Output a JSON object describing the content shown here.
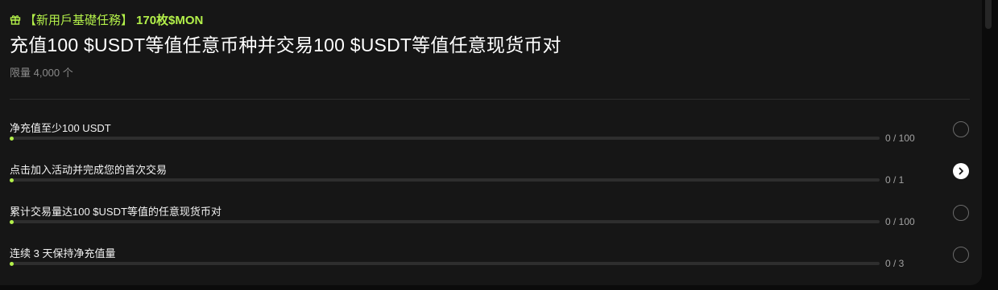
{
  "badge": {
    "icon": "gift-icon",
    "bracket_text": "【新用戶基礎任務】",
    "amount": "170枚$MON",
    "color": "#b3f04a"
  },
  "title": "充值100 $USDT等值任意币种并交易100 $USDT等值任意现货币对",
  "limit": "限量 4,000 个",
  "tasks": [
    {
      "label": "净充值至少100 USDT",
      "count": "0 / 100",
      "progress": 0,
      "status": "incomplete",
      "status_icon": "empty-circle-icon"
    },
    {
      "label": "点击加入活动并完成您的首次交易",
      "count": "0 / 1",
      "progress": 0,
      "status": "actionable",
      "status_icon": "chevron-right-icon"
    },
    {
      "label": "累计交易量达100 $USDT等值的任意现货币对",
      "count": "0 / 100",
      "progress": 0,
      "status": "incomplete",
      "status_icon": "empty-circle-icon"
    },
    {
      "label": "连续 3 天保持净充值量",
      "count": "0 / 3",
      "progress": 0,
      "status": "incomplete",
      "status_icon": "empty-circle-icon"
    }
  ],
  "colors": {
    "accent": "#b3f04a",
    "card_bg": "#161616",
    "page_bg": "#0b0b0b",
    "track": "#2e2e2e"
  }
}
